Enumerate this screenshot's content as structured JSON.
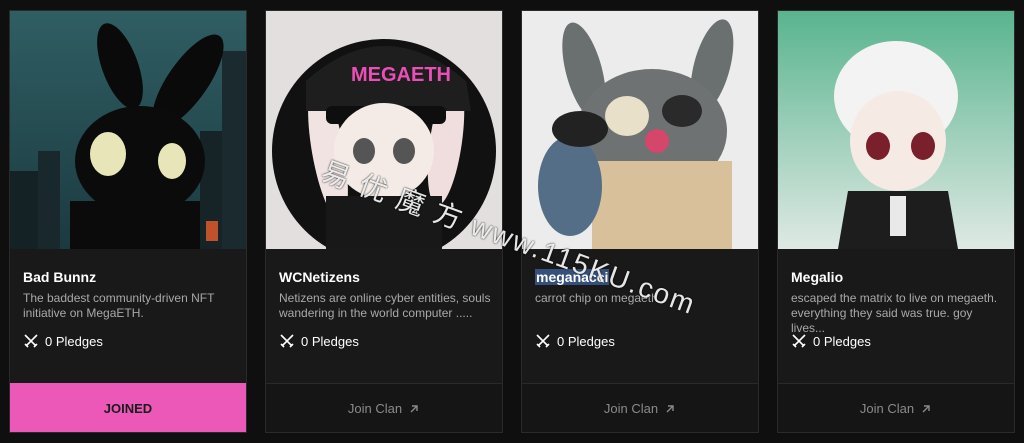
{
  "cards": [
    {
      "title": "Bad Bunnz",
      "description": "The baddest community-driven NFT initiative on MegaETH.",
      "pledges": "0 Pledges",
      "action": "JOINED"
    },
    {
      "title": "WCNetizens",
      "description": "Netizens are online cyber entities, souls wandering in the world computer .....",
      "pledges": "0 Pledges",
      "action": "Join Clan",
      "cap_text": "MEGAETH"
    },
    {
      "title": "meganacci",
      "description": "carrot chip on megaeth",
      "pledges": "0 Pledges",
      "action": "Join Clan"
    },
    {
      "title": "Megalio",
      "description": "escaped the matrix to live on megaeth. everything they said was true. goy lives...",
      "pledges": "0 Pledges",
      "action": "Join Clan"
    }
  ],
  "watermark": "易 优 魔 方 www.115KU.com",
  "colors": {
    "joined_bg": "#eb58b8",
    "card_bg": "#191919",
    "page_bg": "#0f0f10"
  },
  "icons": {
    "pledge": "crossed-swords-icon",
    "join": "arrow-up-right-icon"
  }
}
